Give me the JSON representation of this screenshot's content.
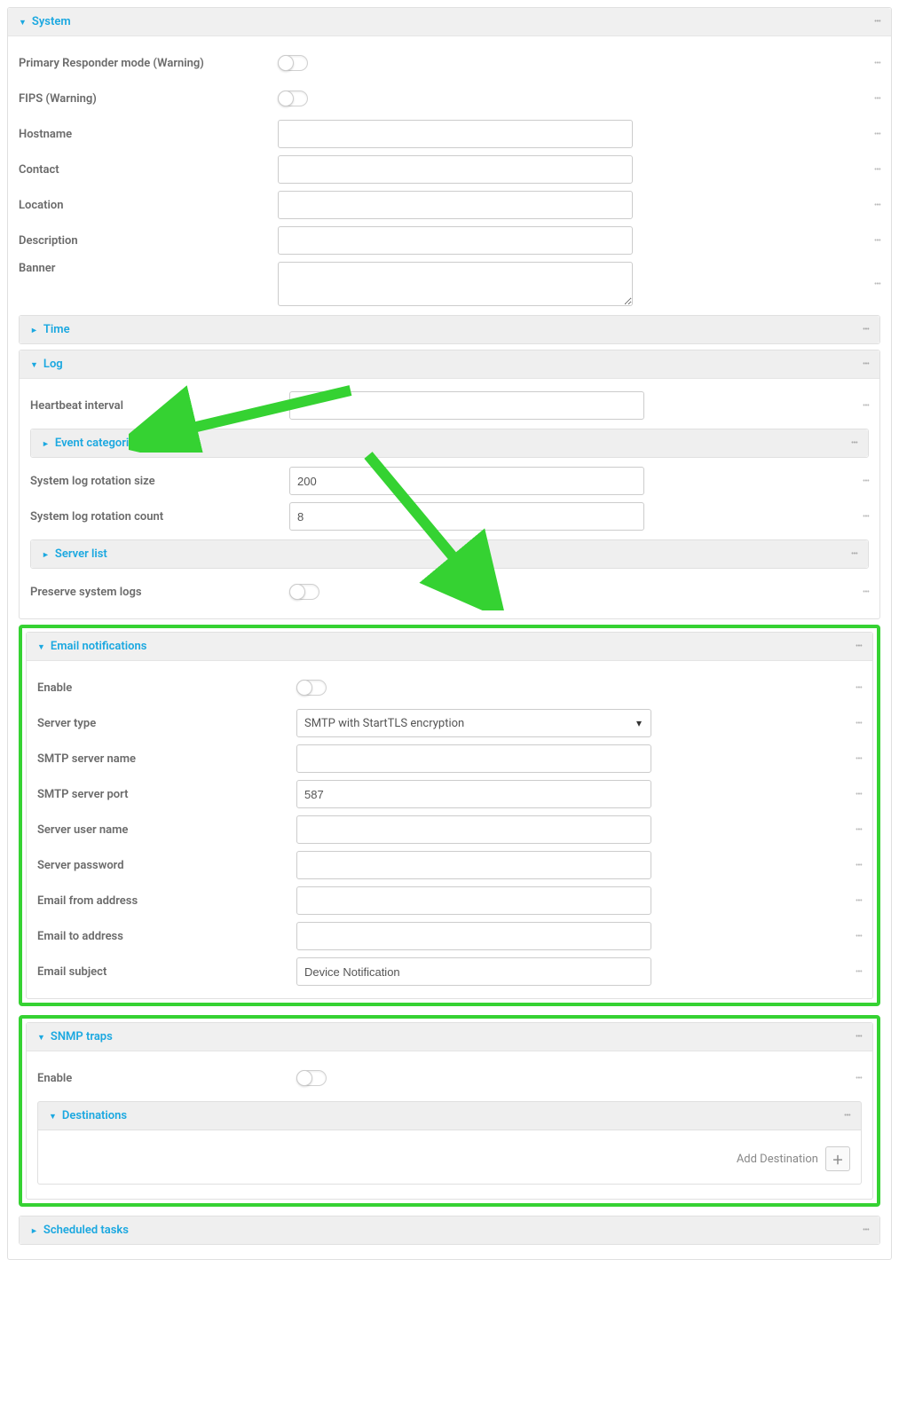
{
  "system": {
    "title": "System",
    "primary_responder_label": "Primary Responder mode (Warning)",
    "primary_responder_on": false,
    "fips_label": "FIPS (Warning)",
    "fips_on": false,
    "hostname_label": "Hostname",
    "hostname_value": "",
    "contact_label": "Contact",
    "contact_value": "",
    "location_label": "Location",
    "location_value": "",
    "description_label": "Description",
    "description_value": "",
    "banner_label": "Banner",
    "banner_value": ""
  },
  "time": {
    "title": "Time"
  },
  "log": {
    "title": "Log",
    "heartbeat_label": "Heartbeat interval",
    "heartbeat_value": "",
    "event_categories_title": "Event categories",
    "rotation_size_label": "System log rotation size",
    "rotation_size_value": "200",
    "rotation_count_label": "System log rotation count",
    "rotation_count_value": "8",
    "server_list_title": "Server list",
    "preserve_logs_label": "Preserve system logs",
    "preserve_logs_on": false
  },
  "email": {
    "title": "Email notifications",
    "enable_label": "Enable",
    "enable_on": false,
    "server_type_label": "Server type",
    "server_type_value": "SMTP with StartTLS encryption",
    "smtp_name_label": "SMTP server name",
    "smtp_name_value": "",
    "smtp_port_label": "SMTP server port",
    "smtp_port_value": "587",
    "server_user_label": "Server user name",
    "server_user_value": "",
    "server_pass_label": "Server password",
    "server_pass_value": "",
    "email_from_label": "Email from address",
    "email_from_value": "",
    "email_to_label": "Email to address",
    "email_to_value": "",
    "email_subject_label": "Email subject",
    "email_subject_value": "Device Notification"
  },
  "snmp": {
    "title": "SNMP traps",
    "enable_label": "Enable",
    "enable_on": false,
    "destinations_title": "Destinations",
    "add_destination_label": "Add Destination"
  },
  "scheduled": {
    "title": "Scheduled tasks"
  }
}
